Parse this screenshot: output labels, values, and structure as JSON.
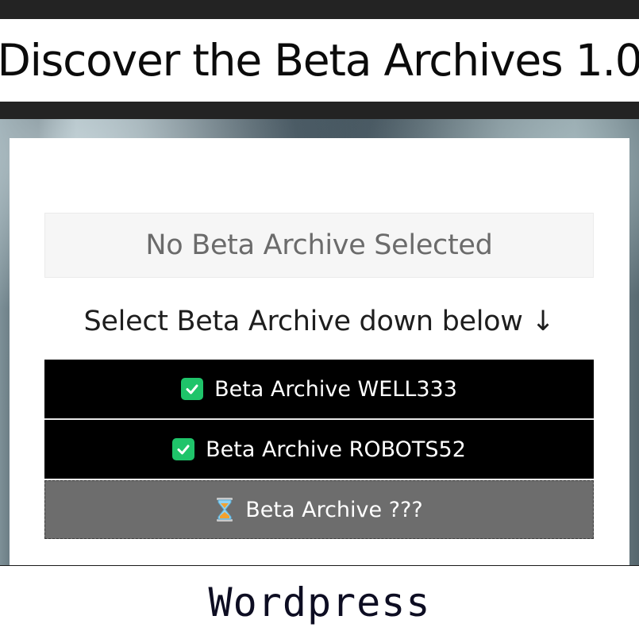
{
  "header": {
    "title": "Discover the Beta Archives 1.0"
  },
  "selection": {
    "display_text": "No Beta Archive Selected"
  },
  "instruction": {
    "text": "Select Beta Archive down below ↓"
  },
  "archives": [
    {
      "label": "Beta Archive WELL333",
      "status_icon": "check-icon",
      "state": "available"
    },
    {
      "label": "Beta Archive ROBOTS52",
      "status_icon": "check-icon",
      "state": "available"
    },
    {
      "label": "Beta Archive ???",
      "status_icon": "hourglass-icon",
      "state": "locked"
    }
  ],
  "footer": {
    "text": "Wordpress"
  },
  "colors": {
    "accent_check": "#1fc46a",
    "button_dark": "#000000",
    "button_locked": "#6d6d6d"
  }
}
